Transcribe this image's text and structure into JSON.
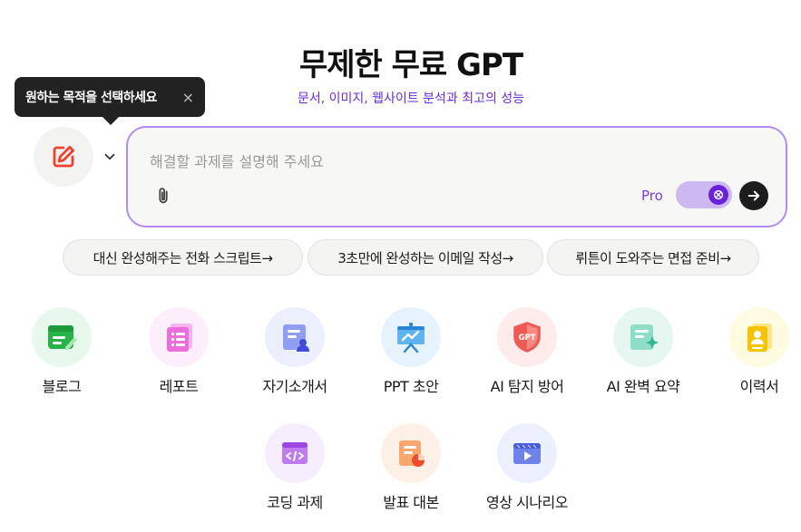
{
  "hero": {
    "title": "무제한 무료 GPT",
    "subtitle": "문서, 이미지, 웹사이트 분석과 최고의 성능"
  },
  "tooltip": {
    "text": "원하는 목적을 선택하세요",
    "close": "×"
  },
  "input": {
    "placeholder": "해결할 과제를 설명해 주세요",
    "pro_label": "Pro"
  },
  "suggestions": [
    {
      "label": "대신 완성해주는 전화 스크립트→"
    },
    {
      "label": "3초만에 완성하는 이메일 작성→"
    },
    {
      "label": "뤼튼이 도와주는 면접 준비→"
    }
  ],
  "tools": [
    {
      "label": "블로그",
      "icon": "blog-icon",
      "bg": "#e9f8ec"
    },
    {
      "label": "레포트",
      "icon": "report-icon",
      "bg": "#fdeefb"
    },
    {
      "label": "자기소개서",
      "icon": "self-intro-icon",
      "bg": "#eceffc"
    },
    {
      "label": "PPT 초안",
      "icon": "ppt-icon",
      "bg": "#e7f3fc"
    },
    {
      "label": "AI 탐지 방어",
      "icon": "ai-detect-shield-icon",
      "bg": "#fdeceb"
    },
    {
      "label": "AI 완벽 요약",
      "icon": "ai-summary-icon",
      "bg": "#e6f7f2"
    },
    {
      "label": "이력서",
      "icon": "resume-icon",
      "bg": "#fffbe0"
    },
    {
      "label": "코딩 과제",
      "icon": "coding-icon",
      "bg": "#f6eefd"
    },
    {
      "label": "발표 대본",
      "icon": "presentation-script-icon",
      "bg": "#fdf0e6"
    },
    {
      "label": "영상 시나리오",
      "icon": "video-scenario-icon",
      "bg": "#eceffc"
    }
  ],
  "colors": {
    "accent": "#6a2cd8",
    "input_border": "#b48bf0",
    "purpose_icon": "#f0412e"
  }
}
